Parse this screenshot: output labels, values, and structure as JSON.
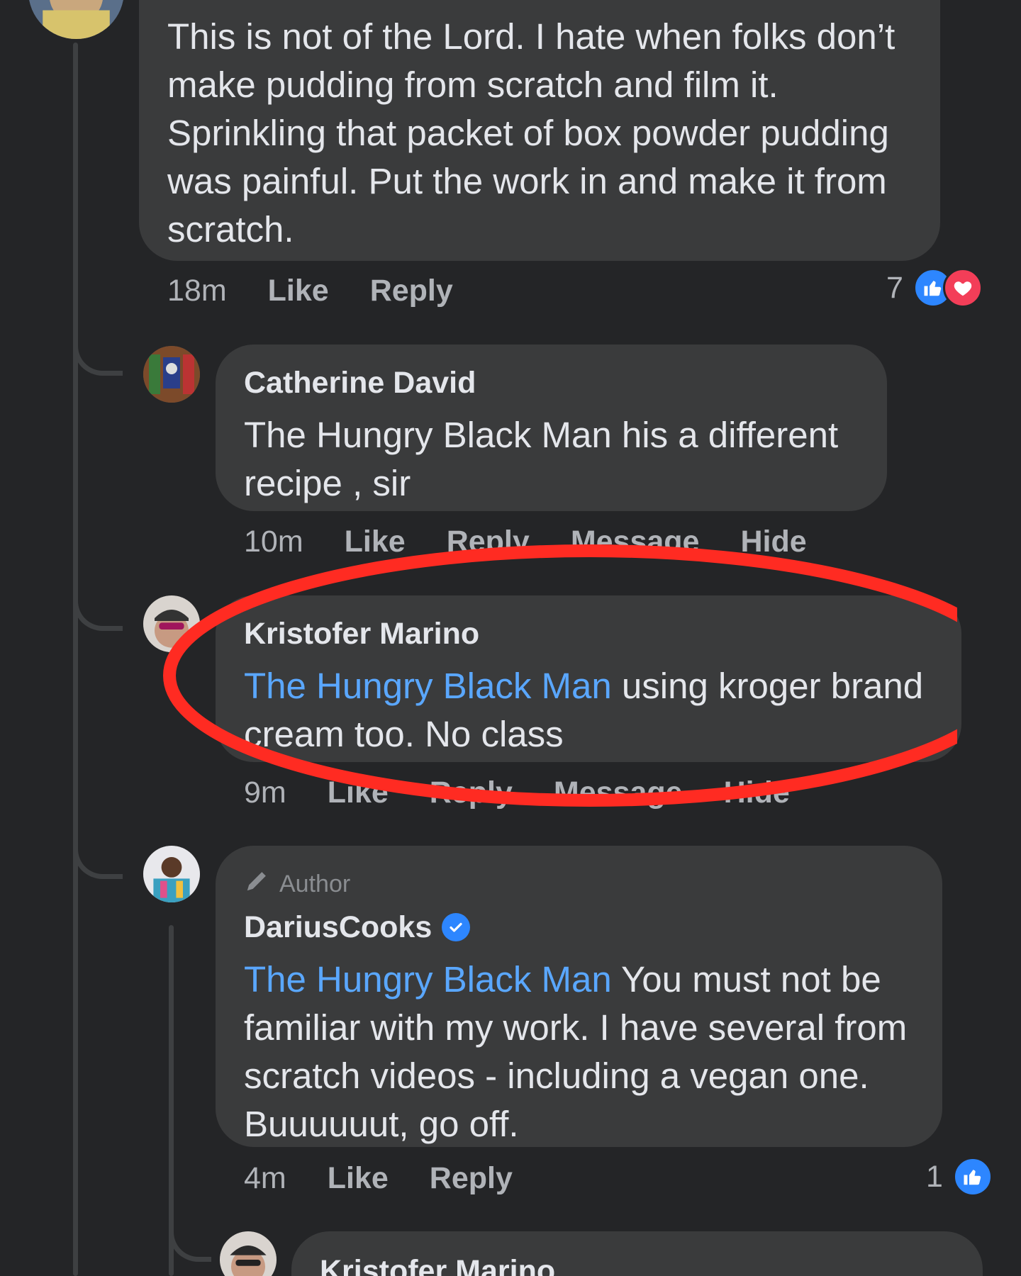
{
  "comments": [
    {
      "text": "This is not of the Lord. I hate when folks don’t make pudding from scratch and film it. Sprinkling that packet of box powder pudding was painful. Put the work in and make it from scratch.",
      "time": "18m",
      "like_label": "Like",
      "reply_label": "Reply",
      "reaction_count": "7"
    },
    {
      "author": "Catherine David",
      "text": "The Hungry Black Man  his a different recipe , sir",
      "time": "10m",
      "like_label": "Like",
      "reply_label": "Reply",
      "message_label": "Message",
      "hide_label": "Hide"
    },
    {
      "author": "Kristofer Marino",
      "mention": "The Hungry Black Man",
      "text": " using kroger brand cream too. No class",
      "time": "9m",
      "like_label": "Like",
      "reply_label": "Reply",
      "message_label": "Message",
      "hide_label": "Hide"
    },
    {
      "badge": "Author",
      "author": "DariusCooks",
      "mention": "The Hungry Black Man",
      "text": " You must not be familiar with my work. I have several from scratch videos - including a vegan one. Buuuuuut, go off.",
      "time": "4m",
      "like_label": "Like",
      "reply_label": "Reply",
      "reaction_count": "1"
    },
    {
      "author": "Kristofer Marino"
    }
  ],
  "colors": {
    "background": "#242527",
    "bubble": "#3a3b3c",
    "mention": "#5aa7ff",
    "like": "#2d86ff",
    "love": "#f33e58",
    "annotation": "#ff2b22"
  },
  "icons": {
    "like": "thumbs-up-icon",
    "love": "heart-icon",
    "verified": "verified-check-icon",
    "author": "pencil-icon"
  }
}
